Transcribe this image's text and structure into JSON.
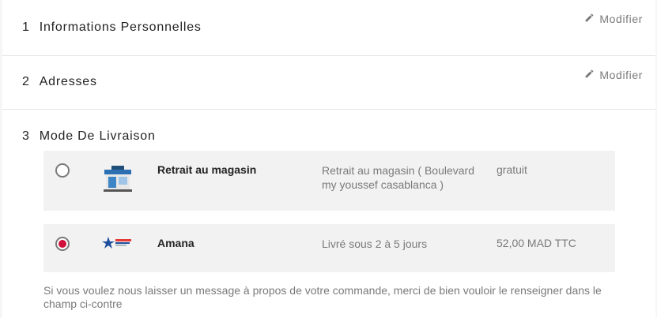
{
  "steps": [
    {
      "number": "1",
      "title": "Informations Personnelles",
      "edit_label": "Modifier"
    },
    {
      "number": "2",
      "title": "Adresses",
      "edit_label": "Modifier"
    },
    {
      "number": "3",
      "title": "Mode De Livraison"
    }
  ],
  "delivery_options": [
    {
      "name": "Retrait au magasin",
      "delay": "Retrait au magasin ( Boulevard my youssef casablanca )",
      "price": "gratuit",
      "selected": false,
      "logo_icon": "store-icon"
    },
    {
      "name": "Amana",
      "delay": "Livré sous 2 à 5 jours",
      "price": "52,00 MAD TTC",
      "selected": true,
      "logo_icon": "amana-logo-icon"
    }
  ],
  "message_text": "Si vous voulez nous laisser un message à propos de votre commande, merci de bien vouloir le renseigner dans le champ ci-contre",
  "colors": {
    "accent": "#d0103a",
    "muted": "#7a7a7a",
    "panel": "#f2f2f2"
  }
}
